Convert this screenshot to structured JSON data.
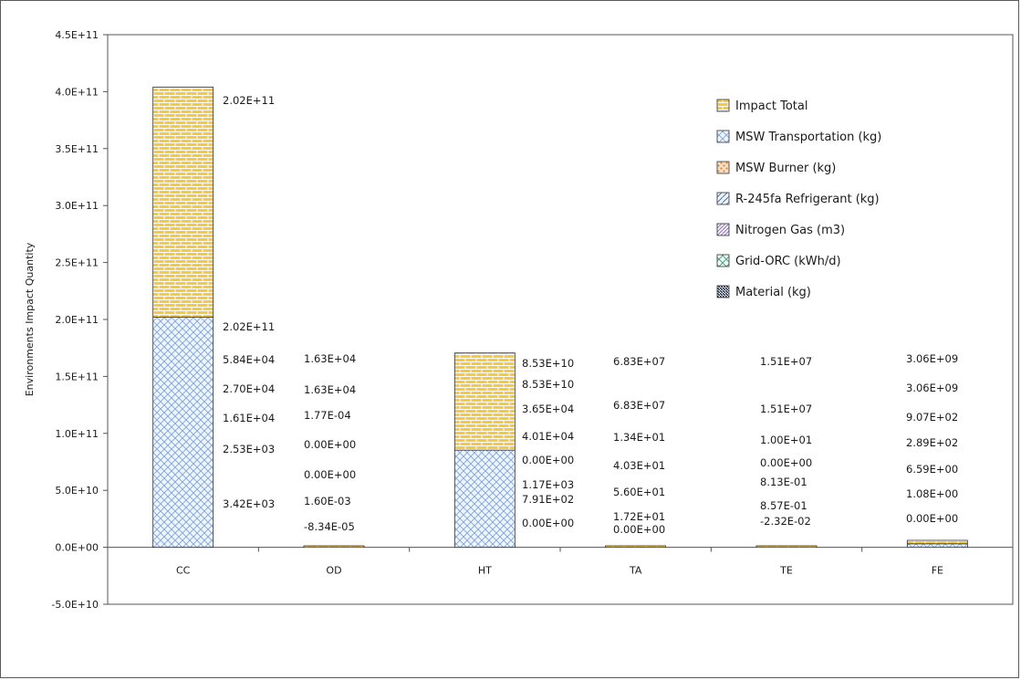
{
  "colors": {
    "impact_total": "#f6c945",
    "impact_total_line": "#ffffff",
    "msw_transportation": "#dce9f8",
    "msw_transportation_line": "#7fa6d6",
    "msw_burner": "#f4c9a2",
    "r245fa": "#dce9f8",
    "nitrogen": "#d9c7ee",
    "grid_orc": "#cfe8df",
    "material": "#1f2a44",
    "axis": "#555555"
  },
  "chart_data": {
    "type": "bar",
    "stacked": true,
    "title": "",
    "xlabel": "",
    "ylabel": "Environments Impact Quantity",
    "categories": [
      "CC",
      "OD",
      "HT",
      "TA",
      "TE",
      "FE"
    ],
    "ylim": [
      -50000000000.0,
      450000000000.0
    ],
    "yticks": [
      -50000000000.0,
      0,
      50000000000.0,
      100000000000.0,
      150000000000.0,
      200000000000.0,
      250000000000.0,
      300000000000.0,
      350000000000.0,
      400000000000.0,
      450000000000.0
    ],
    "ytick_labels": [
      "-5.0E+10",
      "0.0E+00",
      "5.0E+10",
      "1.0E+11",
      "1.5E+11",
      "2.0E+11",
      "2.5E+11",
      "3.0E+11",
      "3.5E+11",
      "4.0E+11",
      "4.5E+11"
    ],
    "grid": false,
    "legend_position": "top-right",
    "series": [
      {
        "name": "Material (kg)",
        "key": "material",
        "values": [
          3420.0,
          0.0016,
          791.0,
          0.0,
          -0.0232,
          0.0
        ]
      },
      {
        "name": "Grid-ORC (kWh/d)",
        "key": "grid_orc",
        "values": [
          0.0,
          -8.34e-05,
          1170.0,
          17.2,
          0.857,
          1.08
        ]
      },
      {
        "name": "Nitrogen Gas (m3)",
        "key": "nitrogen",
        "values": [
          2530.0,
          0.0,
          0.0,
          56.0,
          0.813,
          6.59
        ]
      },
      {
        "name": "R-245fa Refrigerant (kg)",
        "key": "r245fa",
        "values": [
          16100.0,
          0.000177,
          40100.0,
          40.3,
          0.0,
          289.0
        ]
      },
      {
        "name": "MSW Burner (kg)",
        "key": "msw_burner",
        "values": [
          27000.0,
          16300.0,
          36500.0,
          13.4,
          10.0,
          907.0
        ]
      },
      {
        "name": "MSW Transportation (kg)",
        "key": "msw_transportation",
        "values": [
          202000000000.0,
          16300.0,
          85300000000.0,
          68300000.0,
          15100000.0,
          3060000000.0
        ]
      },
      {
        "name": "Impact Total",
        "key": "impact_total",
        "values": [
          202000000000.0,
          16300.0,
          85300000000.0,
          68300000.0,
          15100000.0,
          3060000000.0
        ]
      }
    ],
    "legend_order": [
      "impact_total",
      "msw_transportation",
      "msw_burner",
      "r245fa",
      "nitrogen",
      "grid_orc",
      "material"
    ],
    "data_labels": [
      [
        "3.42E+03",
        "2.53E+03",
        "1.61E+04",
        "2.70E+04",
        "5.84E+04",
        "2.02E+11",
        "2.02E+11"
      ],
      [
        "-8.34E-05",
        "1.60E-03",
        "0.00E+00",
        "0.00E+00",
        "1.77E-04",
        "1.63E+04",
        "1.63E+04"
      ],
      [
        "0.00E+00",
        "7.91E+02",
        "1.17E+03",
        "0.00E+00",
        "4.01E+04",
        "3.65E+04",
        "8.53E+10",
        "8.53E+10"
      ],
      [
        "0.00E+00",
        "1.72E+01",
        "5.60E+01",
        "4.03E+01",
        "1.34E+01",
        "6.83E+07",
        "6.83E+07"
      ],
      [
        "-2.32E-02",
        "8.57E-01",
        "8.13E-01",
        "0.00E+00",
        "1.00E+01",
        "1.51E+07",
        "1.51E+07"
      ],
      [
        "0.00E+00",
        "1.08E+00",
        "6.59E+00",
        "2.89E+02",
        "9.07E+02",
        "3.06E+09",
        "3.06E+09"
      ]
    ]
  }
}
